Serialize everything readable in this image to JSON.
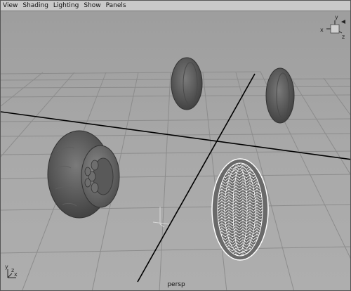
{
  "menubar": {
    "items": [
      "View",
      "Shading",
      "Lighting",
      "Show",
      "Panels"
    ]
  },
  "viewport": {
    "camera_label": "persp"
  },
  "view_cube": {
    "axes": [
      "x",
      "y",
      "z"
    ]
  },
  "origin_axes": {
    "axes": [
      "x",
      "y",
      "z"
    ]
  },
  "colors": {
    "background": "#a8a8a8",
    "grid": "#8c8c8c",
    "axis_line": "#000000",
    "tire_rubber": "#5a5a5a",
    "wireframe_tire": "#ffffff"
  }
}
